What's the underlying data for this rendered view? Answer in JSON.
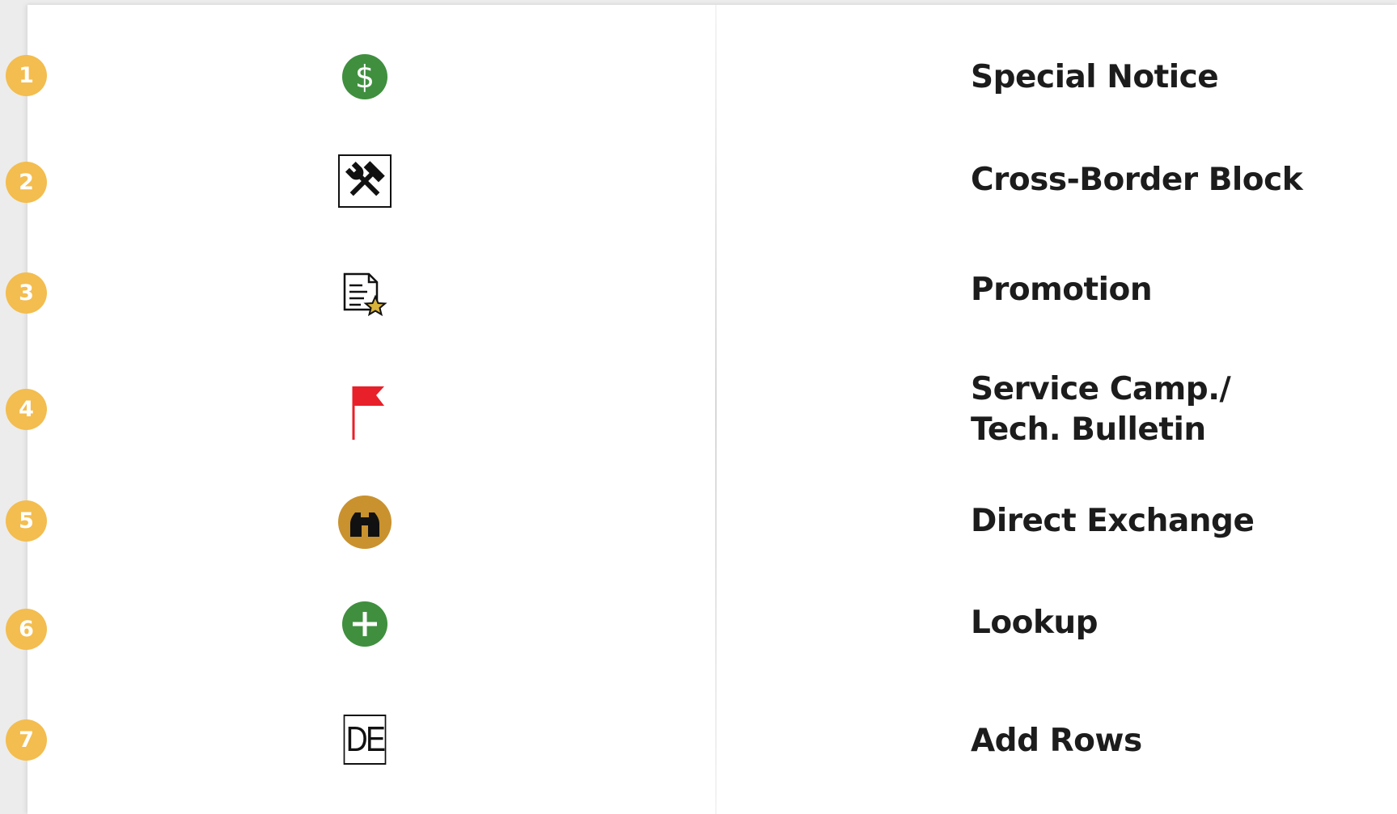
{
  "legend": {
    "rows": [
      {
        "number": "1",
        "icon": "dollar-circle-icon",
        "label": "Special Notice"
      },
      {
        "number": "2",
        "icon": "tools-icon",
        "label": "Cross-Border Block"
      },
      {
        "number": "3",
        "icon": "document-star-icon",
        "label": "Promotion"
      },
      {
        "number": "4",
        "icon": "red-flag-icon",
        "label_line1": "Service Camp./",
        "label_line2": "Tech. Bulletin"
      },
      {
        "number": "5",
        "icon": "binoculars-icon",
        "label": "Direct Exchange"
      },
      {
        "number": "6",
        "icon": "plus-circle-icon",
        "label": "Lookup"
      },
      {
        "number": "7",
        "icon": "de-box-icon",
        "label": "Add Rows",
        "icon_text": "DE"
      }
    ]
  },
  "colors": {
    "badge": "#f3bd4f",
    "green": "#3f8f3f",
    "flag_red": "#e8202a",
    "bronze": "#c9922f",
    "star_gold": "#d9b33a",
    "text": "#1c1c1c"
  }
}
